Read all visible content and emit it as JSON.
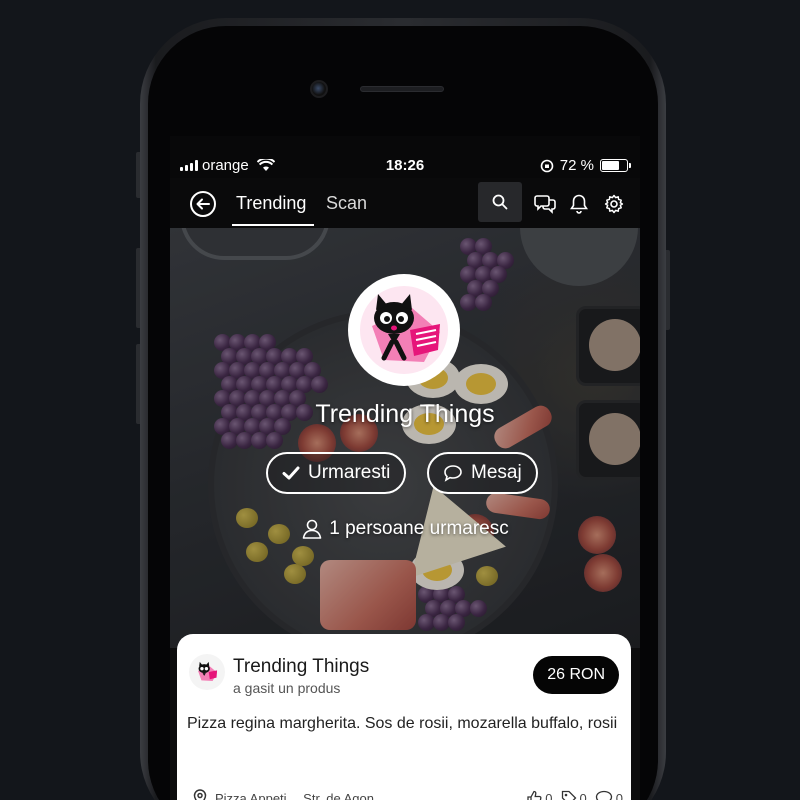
{
  "status_bar": {
    "carrier": "orange",
    "time": "18:26",
    "battery_percent": "72 %",
    "battery_level": 0.72
  },
  "nav": {
    "tabs": [
      {
        "label": "Trending",
        "active": true
      },
      {
        "label": "Scan",
        "active": false
      }
    ],
    "icons": [
      "back-icon",
      "search-icon",
      "chat-icon",
      "bell-icon",
      "gear-icon"
    ]
  },
  "profile": {
    "name": "Trending Things",
    "follow_label": "Urmaresti",
    "message_label": "Mesaj",
    "followers_text": "1 persoane urmaresc"
  },
  "post": {
    "author": "Trending Things",
    "action": "a gasit un produs",
    "price": "26 RON",
    "description": "Pizza regina margherita. Sos de rosii, mozarella buffalo, rosii",
    "location": "Pizza Appeti… Str. de Agon…",
    "likes": "0",
    "tags": "0",
    "comments": "0"
  },
  "colors": {
    "background": "#13161b",
    "accent_pink": "#e6157a",
    "price_badge": "#050505"
  }
}
